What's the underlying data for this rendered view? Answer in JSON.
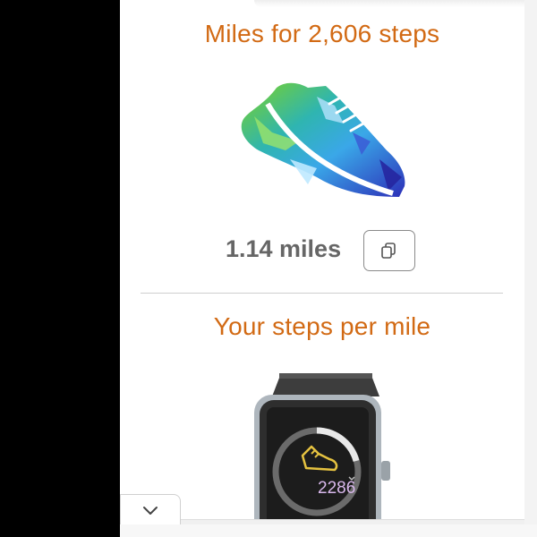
{
  "heading_miles": "Miles for 2,606 steps",
  "result_miles": "1.14 miles",
  "heading_steps": "Your steps per mile",
  "watch_steps": "2286",
  "icons": {
    "shoe": "running-shoe-icon",
    "copy": "copy-icon",
    "watch": "smartwatch-icon",
    "watch_shoe": "shoe-icon",
    "chevron": "chevron-down-icon"
  },
  "colors": {
    "heading": "#d26a14",
    "miles_text": "#666666"
  }
}
